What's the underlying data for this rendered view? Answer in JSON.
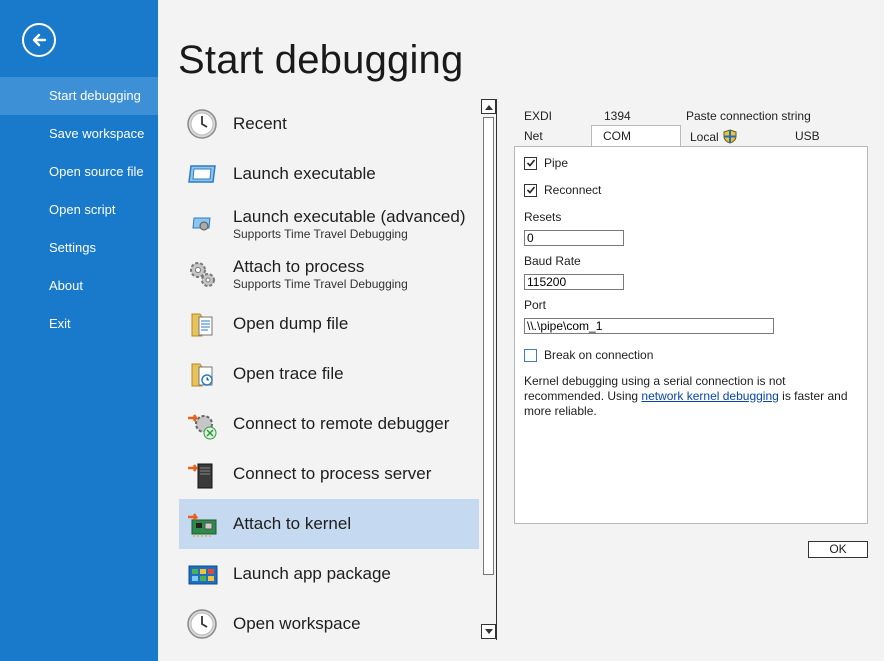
{
  "sidebar": {
    "items": [
      {
        "label": "Start debugging",
        "active": true
      },
      {
        "label": "Save workspace"
      },
      {
        "label": "Open source file"
      },
      {
        "label": "Open script"
      },
      {
        "label": "Settings"
      },
      {
        "label": "About"
      },
      {
        "label": "Exit"
      }
    ]
  },
  "page": {
    "title": "Start debugging"
  },
  "list": {
    "items": [
      {
        "label": "Recent",
        "icon": "clock-icon"
      },
      {
        "label": "Launch executable",
        "icon": "window-icon"
      },
      {
        "label": "Launch executable (advanced)",
        "sub": "Supports Time Travel Debugging",
        "icon": "window-gear-icon"
      },
      {
        "label": "Attach to process",
        "sub": "Supports Time Travel Debugging",
        "icon": "gears-icon"
      },
      {
        "label": "Open dump file",
        "icon": "folder-file-icon"
      },
      {
        "label": "Open trace file",
        "icon": "folder-trace-icon"
      },
      {
        "label": "Connect to remote debugger",
        "icon": "remote-debugger-icon"
      },
      {
        "label": "Connect to process server",
        "icon": "server-icon"
      },
      {
        "label": "Attach to kernel",
        "icon": "circuit-board-icon",
        "selected": true
      },
      {
        "label": "Launch app package",
        "icon": "app-package-icon"
      },
      {
        "label": "Open workspace",
        "icon": "clock-icon"
      }
    ]
  },
  "tabs": {
    "exdi": "EXDI",
    "t1394": "1394",
    "paste": "Paste connection string",
    "net": "Net",
    "com": "COM",
    "local": "Local",
    "usb": "USB"
  },
  "panel": {
    "pipe_label": "Pipe",
    "pipe_checked": true,
    "reconnect_label": "Reconnect",
    "reconnect_checked": true,
    "resets_label": "Resets",
    "resets_value": "0",
    "baud_label": "Baud Rate",
    "baud_value": "115200",
    "port_label": "Port",
    "port_value": "\\\\.\\pipe\\com_1",
    "break_label": "Break on connection",
    "break_checked": false,
    "desc_pre": "Kernel debugging using a serial connection is not recommended. Using ",
    "desc_link": "network kernel debugging",
    "desc_post": " is faster and more reliable."
  },
  "ok_label": "OK",
  "colors": {
    "sidebar": "#1979ca",
    "selected": "#c5d9f1",
    "link": "#0645ad"
  }
}
